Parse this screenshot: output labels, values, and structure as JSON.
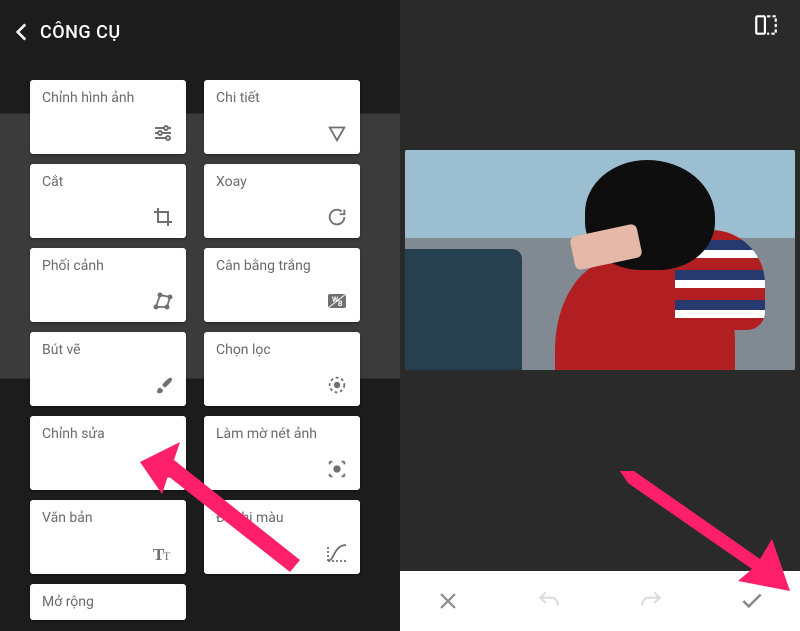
{
  "left": {
    "title": "CÔNG CỤ",
    "tools": [
      {
        "label": "Chỉnh hình ảnh",
        "icon": "tune-icon"
      },
      {
        "label": "Chi tiết",
        "icon": "triangle-down-icon"
      },
      {
        "label": "Cắt",
        "icon": "crop-icon"
      },
      {
        "label": "Xoay",
        "icon": "rotate-icon"
      },
      {
        "label": "Phối cảnh",
        "icon": "perspective-icon"
      },
      {
        "label": "Cân bằng trắng",
        "icon": "wb-icon"
      },
      {
        "label": "Bút vẽ",
        "icon": "brush-icon"
      },
      {
        "label": "Chọn lọc",
        "icon": "selective-icon"
      },
      {
        "label": "Chỉnh sửa",
        "icon": "heal-icon"
      },
      {
        "label": "Làm mờ nét ảnh",
        "icon": "vignette-icon"
      },
      {
        "label": "Văn bản",
        "icon": "text-icon"
      },
      {
        "label": "Đồ thị màu",
        "icon": "curves-icon"
      },
      {
        "label": "Mở rộng",
        "icon": ""
      }
    ]
  },
  "right": {
    "bottom": {
      "cancel": "close-icon",
      "undo": "undo-icon",
      "redo": "redo-icon",
      "apply": "check-icon"
    }
  },
  "annotations": {
    "arrow_color": "#ff1f6b"
  }
}
